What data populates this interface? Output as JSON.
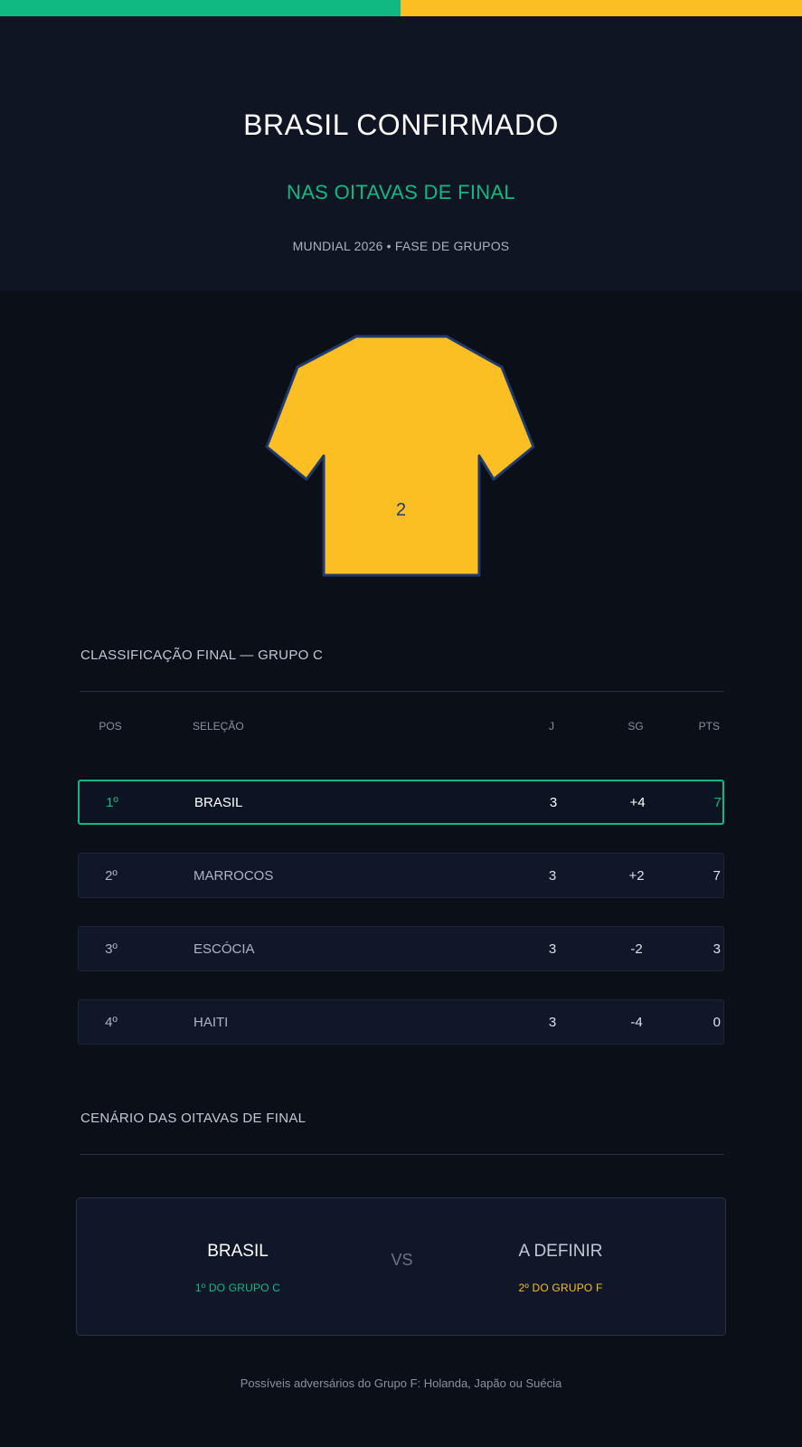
{
  "colors": {
    "accent_green": "#10b981",
    "accent_yellow": "#fbbf24",
    "background": "#0b0f17",
    "jersey_fill": "#fbbf24",
    "jersey_outline": "#1e3a6e"
  },
  "hero": {
    "title": "BRASIL CONFIRMADO",
    "subtitle": "NAS OITAVAS DE FINAL",
    "meta": "MUNDIAL 2026 • FASE DE GRUPOS"
  },
  "jersey": {
    "icon": "jersey-icon",
    "number": "2"
  },
  "standings": {
    "title": "CLASSIFICAÇÃO FINAL — GRUPO C",
    "columns": {
      "pos": "POS",
      "team": "SELEÇÃO",
      "played": "J",
      "goal_diff": "SG",
      "points": "PTS"
    },
    "rows": [
      {
        "pos": "1º",
        "team": "BRASIL",
        "played": "3",
        "goal_diff": "+4",
        "points": "7",
        "highlighted": true
      },
      {
        "pos": "2º",
        "team": "MARROCOS",
        "played": "3",
        "goal_diff": "+2",
        "points": "7"
      },
      {
        "pos": "3º",
        "team": "ESCÓCIA",
        "played": "3",
        "goal_diff": "-2",
        "points": "3"
      },
      {
        "pos": "4º",
        "team": "HAITI",
        "played": "3",
        "goal_diff": "-4",
        "points": "0"
      }
    ]
  },
  "knockout": {
    "title": "CENÁRIO DAS OITAVAS DE FINAL",
    "home": {
      "name": "BRASIL",
      "tag": "1º DO GRUPO C"
    },
    "vs": "VS",
    "away": {
      "name": "A DEFINIR",
      "tag": "2º DO GRUPO F"
    },
    "footnote": "Possíveis adversários do Grupo F: Holanda, Japão ou Suécia"
  }
}
